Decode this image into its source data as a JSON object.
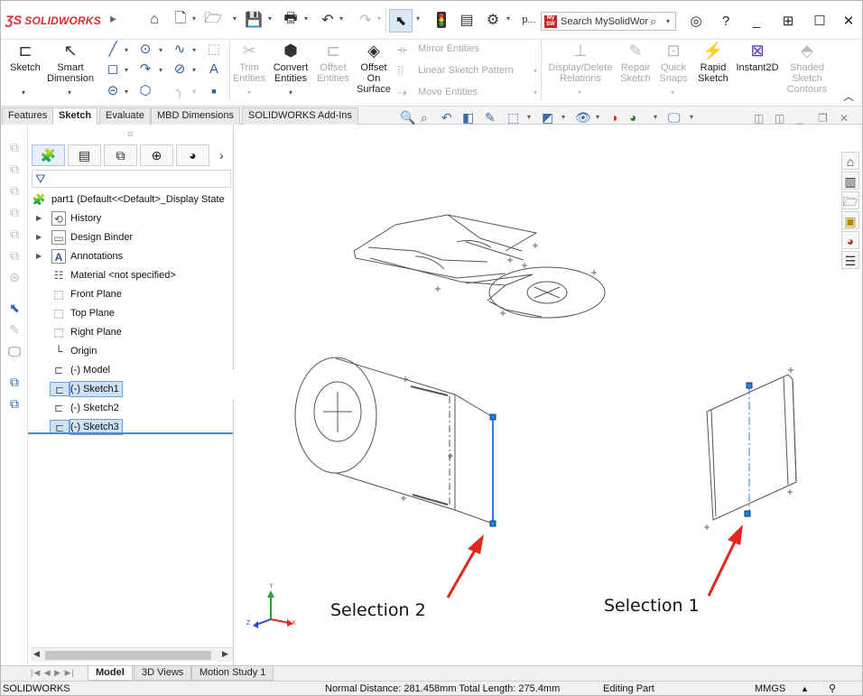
{
  "app": {
    "brand": "SOLIDWORKS",
    "search_placeholder": "Search MySolidWor",
    "search_badge": "My SW",
    "truncated_label": "p..."
  },
  "ribbon": {
    "sketch": "Sketch",
    "smart_dimension": "Smart Dimension",
    "trim_entities": "Trim Entities",
    "convert_entities": "Convert Entities",
    "offset_entities": "Offset Entities",
    "offset_on_surface": "Offset On Surface",
    "mirror_entities": "Mirror Entities",
    "linear_sketch_pattern": "Linear Sketch Pattern",
    "move_entities": "Move Entities",
    "display_delete_relations": "Display/Delete Relations",
    "repair_sketch": "Repair Sketch",
    "quick_snaps": "Quick Snaps",
    "rapid_sketch": "Rapid Sketch",
    "instant2d": "Instant2D",
    "shaded_sketch_contours": "Shaded Sketch Contours"
  },
  "tabs": [
    "Features",
    "Sketch",
    "Evaluate",
    "MBD Dimensions",
    "SOLIDWORKS Add-Ins"
  ],
  "active_tab": "Sketch",
  "tree": {
    "root": "part1  (Default<<Default>_Display State",
    "items": [
      {
        "label": "History",
        "icon": "history-icon"
      },
      {
        "label": "Design Binder",
        "icon": "design-binder-icon"
      },
      {
        "label": "Annotations",
        "icon": "annotations-icon"
      },
      {
        "label": "Material <not specified>",
        "icon": "material-icon"
      },
      {
        "label": "Front Plane",
        "icon": "plane-icon"
      },
      {
        "label": "Top Plane",
        "icon": "plane-icon"
      },
      {
        "label": "Right Plane",
        "icon": "plane-icon"
      },
      {
        "label": "Origin",
        "icon": "origin-icon"
      },
      {
        "label": "(-) Model",
        "icon": "sketch-icon"
      },
      {
        "label": "(-) Sketch1",
        "icon": "sketch-icon"
      },
      {
        "label": "(-) Sketch2",
        "icon": "sketch-icon"
      },
      {
        "label": "(-) Sketch3",
        "icon": "sketch-icon"
      }
    ]
  },
  "graphics": {
    "caption_left": "Selection 2",
    "caption_right": "Selection 1",
    "triad": {
      "x": "X",
      "y": "Y",
      "z": "Z"
    },
    "accent": "#2b7fd6",
    "arrow_color": "#e0261f"
  },
  "bottom_tabs": [
    "Model",
    "3D Views",
    "Motion Study 1"
  ],
  "active_bottom_tab": "Model",
  "status": {
    "app": "SOLIDWORKS",
    "measure": "Normal Distance: 281.458mm Total Length: 275.4mm",
    "mode": "Editing Part",
    "units": "MMGS"
  }
}
